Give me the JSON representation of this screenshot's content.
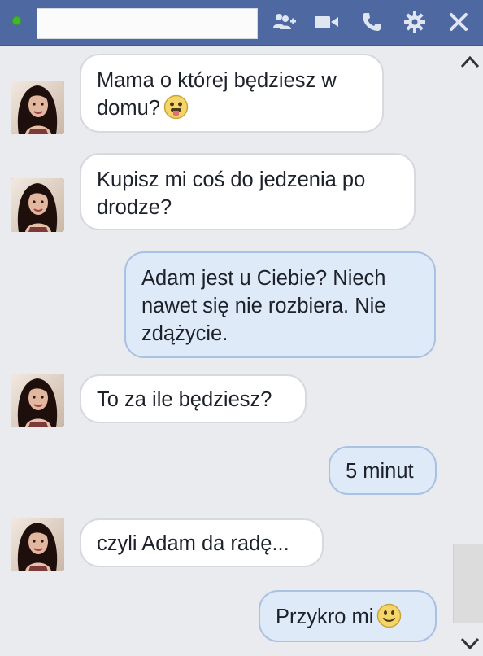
{
  "window": {
    "status": "online",
    "title_field": "",
    "icons": [
      "add-friend-icon",
      "video-call-icon",
      "phone-icon",
      "gear-icon",
      "close-icon"
    ]
  },
  "messages": [
    {
      "sender": "them",
      "text": "Mama o której będziesz w domu?",
      "emoji": "tongue-emoji"
    },
    {
      "sender": "them",
      "text": "Kupisz mi coś do jedzenia po drodze?"
    },
    {
      "sender": "me",
      "text": "Adam jest u Ciebie? Niech nawet się nie rozbiera. Nie zdążycie."
    },
    {
      "sender": "them",
      "text": "To za ile będziesz?"
    },
    {
      "sender": "me",
      "text": "5 minut"
    },
    {
      "sender": "them",
      "text": "czyli Adam da radę..."
    },
    {
      "sender": "me",
      "text": "Przykro mi",
      "emoji": "smile-emoji"
    }
  ],
  "colors": {
    "titlebar": "#4e69a2",
    "status_dot": "#42b72a",
    "incoming_bubble": "#ffffff",
    "outgoing_bubble": "#dfeaf8",
    "outgoing_border": "#a9c1e3",
    "background": "#e9ebee"
  }
}
